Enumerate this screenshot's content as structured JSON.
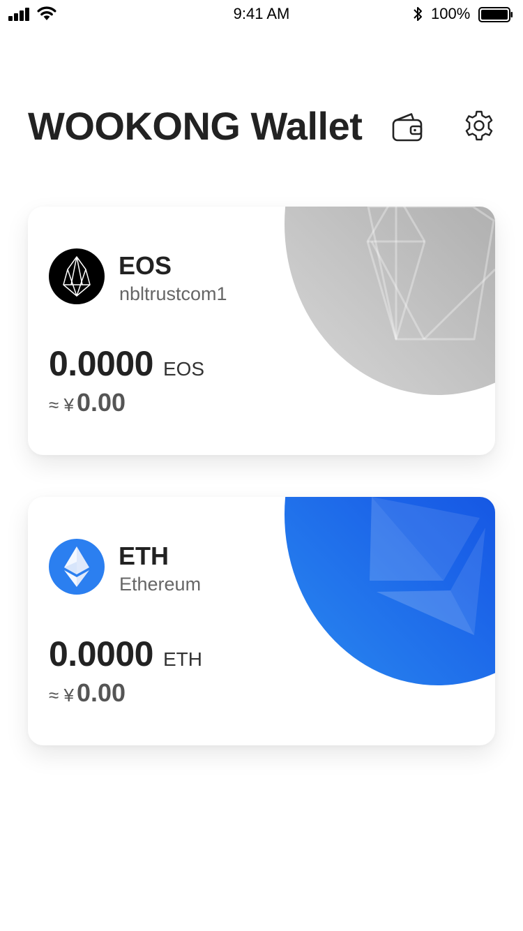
{
  "status_bar": {
    "time": "9:41 AM",
    "battery_percent": "100%",
    "icons": [
      "signal-icon",
      "wifi-icon",
      "bluetooth-icon",
      "battery-icon"
    ]
  },
  "header": {
    "title": "WOOKONG Wallet",
    "icons": [
      "wallet-icon",
      "gear-icon"
    ]
  },
  "wallets": [
    {
      "symbol": "EOS",
      "subtitle": "nbltrustcom1",
      "balance": "0.0000",
      "unit": "EOS",
      "fiat_prefix": "≈ ¥",
      "fiat_value": "0.00",
      "logo_icon": "eos-logo-icon",
      "accent": "#a8a8a8"
    },
    {
      "symbol": "ETH",
      "subtitle": "Ethereum",
      "balance": "0.0000",
      "unit": "ETH",
      "fiat_prefix": "≈ ¥",
      "fiat_value": "0.00",
      "logo_icon": "eth-logo-icon",
      "accent": "#1a5ee8"
    }
  ],
  "colors": {
    "text_primary": "#222222",
    "text_secondary": "#666666",
    "eth_blue": "#2b7ff0",
    "eos_black": "#000000"
  }
}
